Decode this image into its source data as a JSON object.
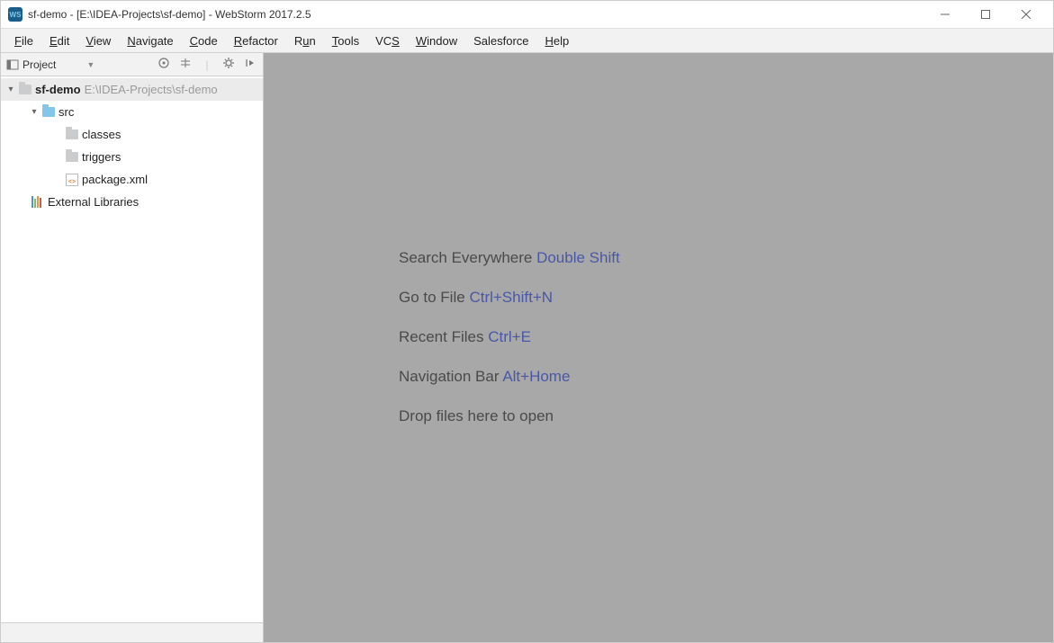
{
  "titlebar": {
    "title": "sf-demo - [E:\\IDEA-Projects\\sf-demo] - WebStorm 2017.2.5"
  },
  "menubar": {
    "items": [
      {
        "label": "File",
        "underline": 0
      },
      {
        "label": "Edit",
        "underline": 0
      },
      {
        "label": "View",
        "underline": 0
      },
      {
        "label": "Navigate",
        "underline": 0
      },
      {
        "label": "Code",
        "underline": 0
      },
      {
        "label": "Refactor",
        "underline": 0
      },
      {
        "label": "Run",
        "underline": 1
      },
      {
        "label": "Tools",
        "underline": 0
      },
      {
        "label": "VCS",
        "underline": 2
      },
      {
        "label": "Window",
        "underline": 0
      },
      {
        "label": "Salesforce",
        "underline": -1
      },
      {
        "label": "Help",
        "underline": 0
      }
    ]
  },
  "sidebar": {
    "header_label": "Project",
    "tree": {
      "root": {
        "name": "sf-demo",
        "path": "E:\\IDEA-Projects\\sf-demo"
      },
      "src": "src",
      "classes": "classes",
      "triggers": "triggers",
      "package": "package.xml",
      "libs": "External Libraries"
    }
  },
  "editor": {
    "tips": [
      {
        "label": "Search Everywhere",
        "shortcut": "Double Shift"
      },
      {
        "label": "Go to File",
        "shortcut": "Ctrl+Shift+N"
      },
      {
        "label": "Recent Files",
        "shortcut": "Ctrl+E"
      },
      {
        "label": "Navigation Bar",
        "shortcut": "Alt+Home"
      }
    ],
    "drop_hint": "Drop files here to open"
  }
}
